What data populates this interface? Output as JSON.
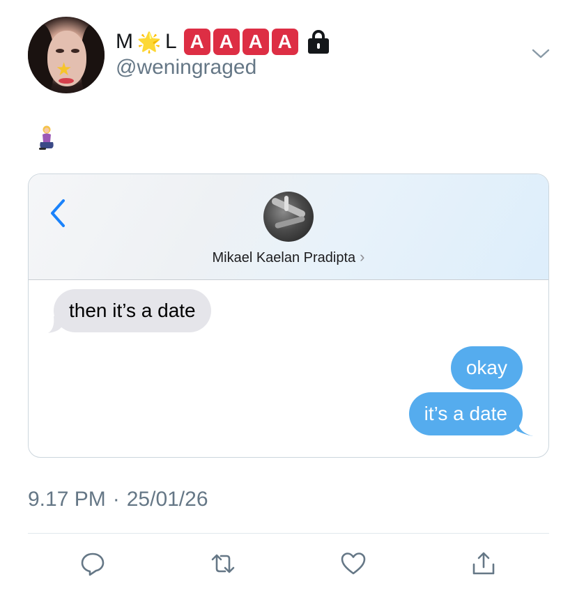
{
  "author": {
    "display_name_prefix": "M",
    "display_name_star": "🌟",
    "display_name_letter": "L",
    "display_name_badges": [
      "A",
      "A",
      "A",
      "A"
    ],
    "handle": "@weningraged",
    "avatar_icon": "star-icon"
  },
  "tweet": {
    "text_emoji": "🧎‍♀️"
  },
  "screenshot": {
    "contact_name": "Mikael Kaelan Pradipta",
    "contact_arrow": "›",
    "messages": [
      {
        "from": "them",
        "text": "then it’s a date"
      },
      {
        "from": "me",
        "text": "okay"
      },
      {
        "from": "me",
        "text": "it’s a date"
      }
    ],
    "colors": {
      "incoming": "#e5e5ea",
      "outgoing": "#55acee",
      "link_blue": "#1a82fb"
    }
  },
  "meta": {
    "time": "9.17 PM",
    "separator": "·",
    "date": "25/01/26"
  },
  "actions": {
    "reply_icon": "reply-icon",
    "retweet_icon": "retweet-icon",
    "like_icon": "heart-icon",
    "share_icon": "share-icon"
  }
}
